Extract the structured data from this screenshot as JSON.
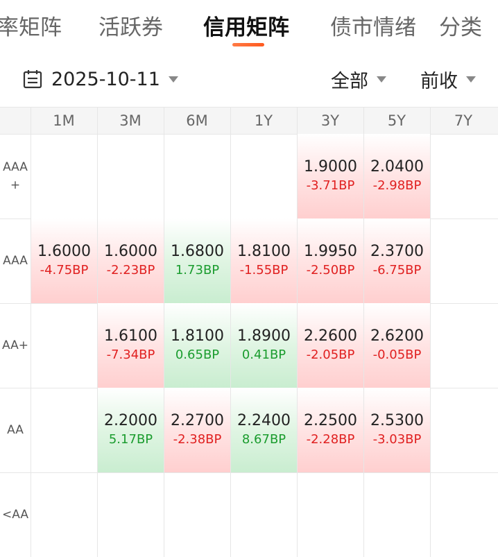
{
  "tabs": [
    {
      "label": "率矩阵",
      "active": false
    },
    {
      "label": "活跃券",
      "active": false
    },
    {
      "label": "信用矩阵",
      "active": true
    },
    {
      "label": "债市情绪",
      "active": false
    },
    {
      "label": "分类",
      "active": false
    }
  ],
  "filters": {
    "date": "2025-10-11",
    "scope": "全部",
    "compare": "前收"
  },
  "colors": {
    "accent": "#ff5a1f",
    "down_text": "#e02020",
    "up_text": "#1a9c2e",
    "down_bg": "#ffd6d6",
    "up_bg": "#d2f0d8"
  },
  "columns": [
    "1M",
    "3M",
    "6M",
    "1Y",
    "3Y",
    "5Y",
    "7Y"
  ],
  "rows": [
    {
      "label": "AAA\n+",
      "cells": [
        null,
        null,
        null,
        null,
        {
          "value": "1.9000",
          "change": "-3.71BP",
          "dir": "down"
        },
        {
          "value": "2.0400",
          "change": "-2.98BP",
          "dir": "down"
        },
        null
      ]
    },
    {
      "label": "AAA",
      "cells": [
        {
          "value": "1.6000",
          "change": "-4.75BP",
          "dir": "down"
        },
        {
          "value": "1.6000",
          "change": "-2.23BP",
          "dir": "down"
        },
        {
          "value": "1.6800",
          "change": "1.73BP",
          "dir": "up"
        },
        {
          "value": "1.8100",
          "change": "-1.55BP",
          "dir": "down"
        },
        {
          "value": "1.9950",
          "change": "-2.50BP",
          "dir": "down"
        },
        {
          "value": "2.3700",
          "change": "-6.75BP",
          "dir": "down"
        },
        null
      ]
    },
    {
      "label": "AA+",
      "cells": [
        null,
        {
          "value": "1.6100",
          "change": "-7.34BP",
          "dir": "down"
        },
        {
          "value": "1.8100",
          "change": "0.65BP",
          "dir": "up"
        },
        {
          "value": "1.8900",
          "change": "0.41BP",
          "dir": "up"
        },
        {
          "value": "2.2600",
          "change": "-2.05BP",
          "dir": "down"
        },
        {
          "value": "2.6200",
          "change": "-0.05BP",
          "dir": "down"
        },
        null
      ]
    },
    {
      "label": "AA",
      "cells": [
        null,
        {
          "value": "2.2000",
          "change": "5.17BP",
          "dir": "up"
        },
        {
          "value": "2.2700",
          "change": "-2.38BP",
          "dir": "down"
        },
        {
          "value": "2.2400",
          "change": "8.67BP",
          "dir": "up"
        },
        {
          "value": "2.2500",
          "change": "-2.28BP",
          "dir": "down"
        },
        {
          "value": "2.5300",
          "change": "-3.03BP",
          "dir": "down"
        },
        null
      ]
    },
    {
      "label": "<AA",
      "cells": [
        null,
        null,
        null,
        null,
        null,
        null,
        null
      ]
    }
  ]
}
